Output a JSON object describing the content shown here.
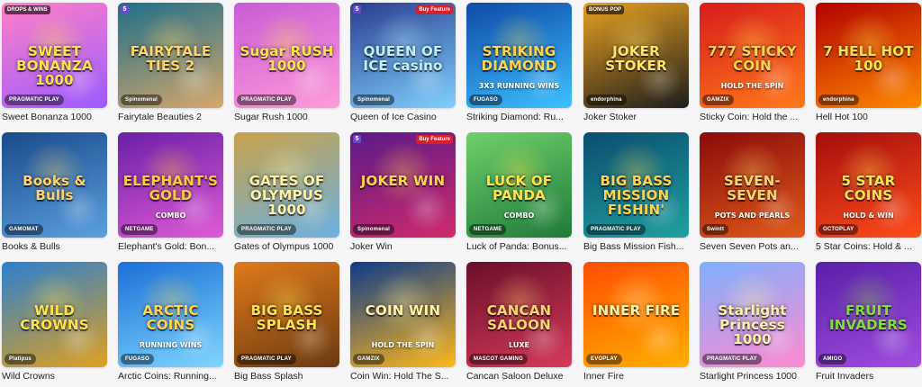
{
  "games": [
    {
      "label": "Sweet Bonanza 1000",
      "thumb_title": "SWEET BONANZA 1000",
      "thumb_subtitle": "",
      "provider": "PRAGMATIC PLAY",
      "badge": "DROPS & WINS",
      "num_badge": "",
      "colors": [
        "#ff7fc8",
        "#9b5cff"
      ],
      "accent": "#ffe14d"
    },
    {
      "label": "Fairytale Beauties 2",
      "thumb_title": "FAIRYTALE TIES 2",
      "thumb_subtitle": "",
      "provider": "Spinomenal",
      "badge": "",
      "num_badge": "5",
      "colors": [
        "#1f6e8a",
        "#d6a86b"
      ],
      "accent": "#ffd36b"
    },
    {
      "label": "Sugar Rush 1000",
      "thumb_title": "Sugar RUSH 1000",
      "thumb_subtitle": "",
      "provider": "PRAGMATIC PLAY",
      "badge": "",
      "num_badge": "",
      "colors": [
        "#c85bd6",
        "#ff9bd9"
      ],
      "accent": "#ffe14d"
    },
    {
      "label": "Queen of Ice Casino",
      "thumb_title": "QUEEN OF ICE casino",
      "thumb_subtitle": "",
      "provider": "Spinomenal",
      "badge": "Buy Feature",
      "num_badge": "5",
      "colors": [
        "#2a3d8f",
        "#7fd0ff"
      ],
      "accent": "#bdf0ff"
    },
    {
      "label": "Striking Diamond: Ru...",
      "thumb_title": "STRIKING DIAMOND",
      "thumb_subtitle": "3X3 RUNNING WINS",
      "provider": "FUGASO",
      "badge": "",
      "num_badge": "",
      "colors": [
        "#0e4aa8",
        "#3dc1ff"
      ],
      "accent": "#ffd34d"
    },
    {
      "label": "Joker Stoker",
      "thumb_title": "JOKER STOKER",
      "thumb_subtitle": "",
      "provider": "endorphina",
      "badge": "BONUS POP",
      "num_badge": "",
      "colors": [
        "#e8a020",
        "#1d1d1d"
      ],
      "accent": "#ffe36b"
    },
    {
      "label": "Sticky Coin: Hold the ...",
      "thumb_title": "777 STICKY COIN",
      "thumb_subtitle": "HOLD THE SPIN",
      "provider": "GAMZIX",
      "badge": "",
      "num_badge": "",
      "colors": [
        "#d81b1b",
        "#ff7a1a"
      ],
      "accent": "#ffd34d"
    },
    {
      "label": "Hell Hot 100",
      "thumb_title": "7 HELL HOT 100",
      "thumb_subtitle": "",
      "provider": "endorphina",
      "badge": "",
      "num_badge": "",
      "colors": [
        "#b30000",
        "#ff8a00"
      ],
      "accent": "#ffe14d"
    },
    {
      "label": "Books & Bulls",
      "thumb_title": "Books & Bulls",
      "thumb_subtitle": "",
      "provider": "GAMOMAT",
      "badge": "",
      "num_badge": "",
      "colors": [
        "#1a4a8a",
        "#5ba0e0"
      ],
      "accent": "#ffd36b"
    },
    {
      "label": "Elephant's Gold: Bon...",
      "thumb_title": "ELEPHANT'S GOLD",
      "thumb_subtitle": "COMBO",
      "provider": "NETGAME",
      "badge": "",
      "num_badge": "",
      "colors": [
        "#6a1fa8",
        "#e05bd6"
      ],
      "accent": "#ffc93c"
    },
    {
      "label": "Gates of Olympus 1000",
      "thumb_title": "GATES OF OLYMPUS 1000",
      "thumb_subtitle": "",
      "provider": "PRAGMATIC PLAY",
      "badge": "",
      "num_badge": "",
      "colors": [
        "#c9a24b",
        "#6bb0e0"
      ],
      "accent": "#fff1a8"
    },
    {
      "label": "Joker Win",
      "thumb_title": "JOKER WIN",
      "thumb_subtitle": "",
      "provider": "Spinomenal",
      "badge": "Buy Feature",
      "num_badge": "5",
      "colors": [
        "#5a1a8a",
        "#d12a6b"
      ],
      "accent": "#ffd34d"
    },
    {
      "label": "Luck of Panda: Bonus...",
      "thumb_title": "LUCK OF PANDA",
      "thumb_subtitle": "COMBO",
      "provider": "NETGAME",
      "badge": "",
      "num_badge": "",
      "colors": [
        "#6fd06b",
        "#1f7a3a"
      ],
      "accent": "#ffe14d"
    },
    {
      "label": "Big Bass Mission Fish...",
      "thumb_title": "BIG BASS MISSION FISHIN'",
      "thumb_subtitle": "",
      "provider": "PRAGMATIC PLAY",
      "badge": "",
      "num_badge": "",
      "colors": [
        "#0b4d6e",
        "#1fa0a0"
      ],
      "accent": "#ffd34d"
    },
    {
      "label": "Seven Seven Pots an...",
      "thumb_title": "SEVEN-SEVEN",
      "thumb_subtitle": "POTS AND PEARLS",
      "provider": "Swintt",
      "badge": "",
      "num_badge": "",
      "colors": [
        "#8a0a0a",
        "#e05a1a"
      ],
      "accent": "#ffd36b"
    },
    {
      "label": "5 Star Coins: Hold & ...",
      "thumb_title": "5 STAR COINS",
      "thumb_subtitle": "HOLD & WIN",
      "provider": "OCTOPLAY",
      "badge": "",
      "num_badge": "",
      "colors": [
        "#a30d0d",
        "#ff4d1a"
      ],
      "accent": "#ffe14d"
    },
    {
      "label": "Wild Crowns",
      "thumb_title": "WILD CROWNS",
      "thumb_subtitle": "",
      "provider": "Platipus",
      "badge": "",
      "num_badge": "",
      "colors": [
        "#2b7fd0",
        "#e0a020"
      ],
      "accent": "#ffe14d"
    },
    {
      "label": "Arctic Coins: Running...",
      "thumb_title": "ARCTIC COINS",
      "thumb_subtitle": "RUNNING WINS",
      "provider": "FUGASO",
      "badge": "",
      "num_badge": "",
      "colors": [
        "#1c6fd6",
        "#7fd6ff"
      ],
      "accent": "#ffd34d"
    },
    {
      "label": "Big Bass Splash",
      "thumb_title": "BIG BASS SPLASH",
      "thumb_subtitle": "",
      "provider": "PRAGMATIC PLAY",
      "badge": "",
      "num_badge": "",
      "colors": [
        "#e07a1a",
        "#6a3a12"
      ],
      "accent": "#ffe14d"
    },
    {
      "label": "Coin Win: Hold The S...",
      "thumb_title": "COIN WIN",
      "thumb_subtitle": "HOLD THE SPIN",
      "provider": "GAMZIX",
      "badge": "",
      "num_badge": "",
      "colors": [
        "#0e3a8a",
        "#ffb81a"
      ],
      "accent": "#fff1a8"
    },
    {
      "label": "Cancan Saloon Deluxe",
      "thumb_title": "CANCAN SALOON",
      "thumb_subtitle": "LUXE",
      "provider": "MASCOT GAMING",
      "badge": "",
      "num_badge": "",
      "colors": [
        "#6a0f2a",
        "#d63a5a"
      ],
      "accent": "#ffd36b"
    },
    {
      "label": "Inner Fire",
      "thumb_title": "INNER FIRE",
      "thumb_subtitle": "",
      "provider": "EVOPLAY",
      "badge": "",
      "num_badge": "",
      "colors": [
        "#ff4d00",
        "#ffb000"
      ],
      "accent": "#fff1a8"
    },
    {
      "label": "Starlight Princess 1000",
      "thumb_title": "Starlight Princess 1000",
      "thumb_subtitle": "",
      "provider": "PRAGMATIC PLAY",
      "badge": "",
      "num_badge": "",
      "colors": [
        "#7fb0ff",
        "#ff8ad0"
      ],
      "accent": "#fff1a8"
    },
    {
      "label": "Fruit Invaders",
      "thumb_title": "FRUIT INVADERS",
      "thumb_subtitle": "",
      "provider": "AMIGO",
      "badge": "",
      "num_badge": "",
      "colors": [
        "#5a1fa8",
        "#a04de0"
      ],
      "accent": "#7fe03a"
    }
  ]
}
